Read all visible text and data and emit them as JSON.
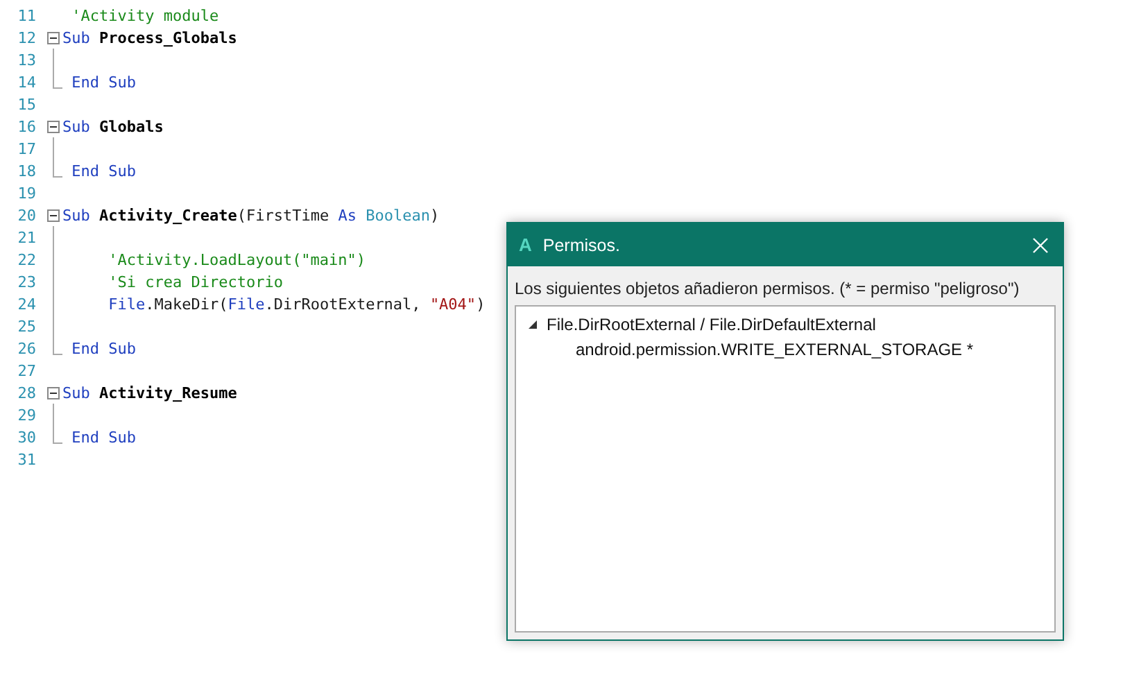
{
  "code_lines": [
    {
      "number": "11",
      "tokens": [
        {
          "kind": "comment",
          "text": " 'Activity module"
        }
      ]
    },
    {
      "number": "12",
      "fold_start": true,
      "tokens": [
        {
          "kind": "keyword",
          "text": "Sub "
        },
        {
          "kind": "name",
          "text": "Process_Globals"
        }
      ]
    },
    {
      "number": "13",
      "fold_body": true
    },
    {
      "number": "14",
      "fold_end": true,
      "tokens": [
        {
          "kind": "keyword",
          "text": " End Sub"
        }
      ]
    },
    {
      "number": "15"
    },
    {
      "number": "16",
      "fold_start": true,
      "tokens": [
        {
          "kind": "keyword",
          "text": "Sub "
        },
        {
          "kind": "name",
          "text": "Globals"
        }
      ]
    },
    {
      "number": "17",
      "fold_body": true
    },
    {
      "number": "18",
      "fold_end": true,
      "tokens": [
        {
          "kind": "keyword",
          "text": " End Sub"
        }
      ]
    },
    {
      "number": "19"
    },
    {
      "number": "20",
      "fold_start": true,
      "tokens": [
        {
          "kind": "keyword",
          "text": "Sub "
        },
        {
          "kind": "name",
          "text": "Activity_Create"
        },
        {
          "kind": "plain",
          "text": "(FirstTime "
        },
        {
          "kind": "keyword",
          "text": "As "
        },
        {
          "kind": "type",
          "text": "Boolean"
        },
        {
          "kind": "plain",
          "text": ")"
        }
      ]
    },
    {
      "number": "21",
      "fold_body": true
    },
    {
      "number": "22",
      "fold_body": true,
      "tokens": [
        {
          "kind": "comment",
          "text": "     'Activity.LoadLayout(\"main\")"
        }
      ]
    },
    {
      "number": "23",
      "fold_body": true,
      "tokens": [
        {
          "kind": "comment",
          "text": "     'Si crea Directorio"
        }
      ]
    },
    {
      "number": "24",
      "fold_body": true,
      "tokens": [
        {
          "kind": "keyword",
          "text": "     File"
        },
        {
          "kind": "plain",
          "text": ".MakeDir("
        },
        {
          "kind": "keyword",
          "text": "File"
        },
        {
          "kind": "plain",
          "text": ".DirRootExternal, "
        },
        {
          "kind": "string",
          "text": "\"A04\""
        },
        {
          "kind": "plain",
          "text": ")"
        }
      ]
    },
    {
      "number": "25",
      "fold_body": true
    },
    {
      "number": "26",
      "fold_end": true,
      "tokens": [
        {
          "kind": "keyword",
          "text": " End Sub"
        }
      ]
    },
    {
      "number": "27"
    },
    {
      "number": "28",
      "fold_start": true,
      "tokens": [
        {
          "kind": "keyword",
          "text": "Sub "
        },
        {
          "kind": "name",
          "text": "Activity_Resume"
        }
      ]
    },
    {
      "number": "29",
      "fold_body": true
    },
    {
      "number": "30",
      "fold_end": true,
      "tokens": [
        {
          "kind": "keyword",
          "text": " End Sub"
        }
      ]
    },
    {
      "number": "31"
    }
  ],
  "dialog": {
    "app_letter": "A",
    "title": "Permisos.",
    "message": "Los siguientes objetos añadieron permisos. (* = permiso \"peligroso\")",
    "tree": [
      {
        "label": "File.DirRootExternal / File.DirDefaultExternal",
        "expanded": true,
        "children": [
          {
            "label": "android.permission.WRITE_EXTERNAL_STORAGE *"
          }
        ]
      }
    ]
  }
}
